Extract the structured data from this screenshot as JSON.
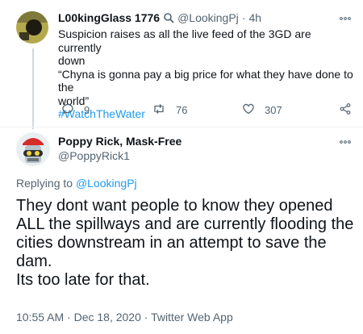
{
  "tweet1": {
    "name": "L00kingGlass 1776",
    "handle": "@LookingPj",
    "sep": "·",
    "time": "4h",
    "lines": [
      "Suspicion raises as all the live feed  of the 3GD are currently",
      "down",
      "“Chyna is gonna pay a big price for what they have done to the",
      "world”"
    ],
    "hashtag": "#WatchTheWater",
    "replies": "9",
    "retweets": "76",
    "likes": "307"
  },
  "tweet2": {
    "name": "Poppy Rick, Mask-Free",
    "handle": "@PoppyRick1",
    "replying_prefix": "Replying to ",
    "replying_handle": "@LookingPj",
    "lines": [
      "They dont want people to know they opened",
      "ALL the spillways and are currently flooding the",
      "cities downstream in an attempt to save the",
      "dam.",
      "Its too late for that."
    ],
    "timestamp": "10:55 AM · Dec 18, 2020 · Twitter Web App"
  },
  "icons": {
    "more": "more-icon",
    "magnifier": "magnifier-icon",
    "reply": "reply-icon",
    "retweet": "retweet-icon",
    "like": "like-icon",
    "share": "share-icon"
  },
  "colors": {
    "link": "#1d9bf0",
    "muted": "#536471",
    "text": "#0f1419"
  }
}
